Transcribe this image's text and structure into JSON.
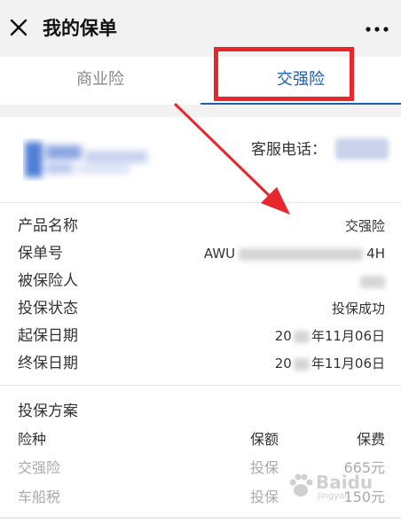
{
  "header": {
    "title": "我的保单"
  },
  "tabs": [
    {
      "label": "商业险",
      "active": false
    },
    {
      "label": "交强险",
      "active": true
    }
  ],
  "card": {
    "cs_label": "客服电话："
  },
  "details": {
    "rows": [
      {
        "label": "产品名称",
        "value": "交强险"
      },
      {
        "label": "保单号",
        "value_prefix": "AWU",
        "value_suffix": "4H"
      },
      {
        "label": "被保险人"
      },
      {
        "label": "投保状态",
        "value": "投保成功"
      },
      {
        "label": "起保日期",
        "value_prefix": "20",
        "value_suffix": "年11月06日"
      },
      {
        "label": "终保日期",
        "value_prefix": "20",
        "value_suffix": "年11月06日"
      }
    ]
  },
  "plan": {
    "title": "投保方案",
    "headers": [
      "险种",
      "保额",
      "保费"
    ],
    "items": [
      {
        "name": "交强险",
        "amount": "投保",
        "premium": "665元"
      },
      {
        "name": "车船税",
        "amount": "投保",
        "premium": "150元"
      }
    ]
  },
  "watermark": {
    "text": "Baidu",
    "sub": "jingyan"
  },
  "colors": {
    "accent": "#1a5fb4",
    "highlight": "#e8262b"
  }
}
